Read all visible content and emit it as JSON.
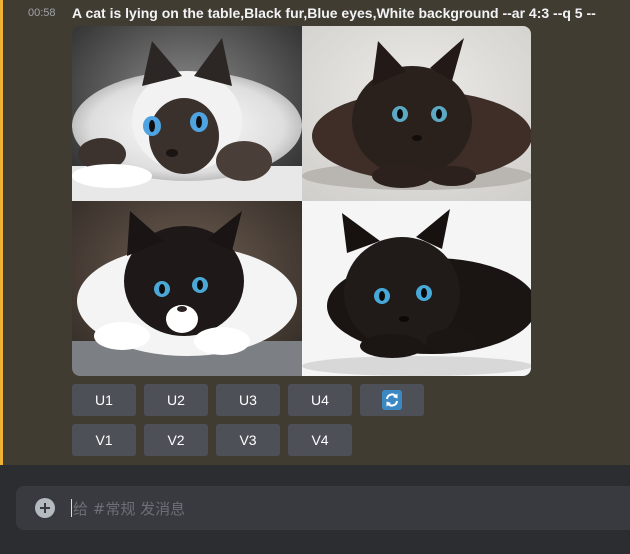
{
  "message": {
    "timestamp": "00:58",
    "prompt": "A cat is lying on the table,Black fur,Blue eyes,White background --ar 4:3 --q 5 --",
    "highlight_color": "#f0b232"
  },
  "images": [
    {
      "label": "image-1",
      "palette": "white fluffy cat with dark face, blue eyes, lying on white table"
    },
    {
      "label": "image-2",
      "palette": "dark brown fluffy cat, blue eyes, light background"
    },
    {
      "label": "image-3",
      "palette": "black and white long-hair cat, blue eyes, lying on table"
    },
    {
      "label": "image-4",
      "palette": "black long-hair cat, blue eyes, white background"
    }
  ],
  "upscale_buttons": [
    "U1",
    "U2",
    "U3",
    "U4"
  ],
  "reroll_icon": "reroll-icon",
  "variation_buttons": [
    "V1",
    "V2",
    "V3",
    "V4"
  ],
  "composer": {
    "placeholder": "给 #常规 发消息",
    "add_icon": "plus-circle-icon"
  }
}
